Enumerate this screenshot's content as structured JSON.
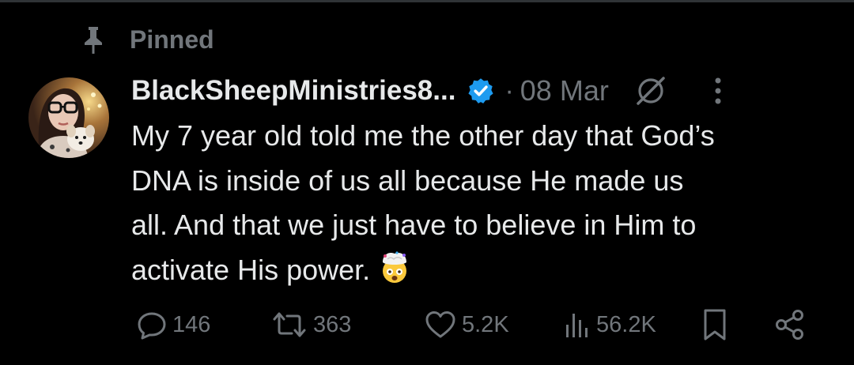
{
  "pinned": {
    "label": "Pinned",
    "icon": "pin-icon"
  },
  "post": {
    "author": {
      "display_name": "BlackSheepMinistries8...",
      "verified_icon": "verified-badge-icon",
      "avatar_icon": "profile-photo-avatar"
    },
    "separator": "·",
    "date": "08 Mar",
    "grok_icon": "grok-slash-circle-icon",
    "more_icon": "more-vertical-icon",
    "text": "My 7 year old told me the other day that God’s\nDNA is inside of us all because He made us\nall. And that we just have to believe in Him to\nactivate His power.",
    "emoji_icon": "exploding-head-emoji"
  },
  "actions": {
    "replies": {
      "count": "146",
      "icon": "reply-bubble-icon"
    },
    "reposts": {
      "count": "363",
      "icon": "repost-icon"
    },
    "likes": {
      "count": "5.2K",
      "icon": "heart-icon"
    },
    "views": {
      "count": "56.2K",
      "icon": "views-chart-icon"
    },
    "bookmark": {
      "icon": "bookmark-icon"
    },
    "share": {
      "icon": "share-icon"
    }
  },
  "colors": {
    "background": "#000000",
    "text_primary": "#e7e9ea",
    "text_secondary": "#71767b",
    "verified_blue": "#1d9bf0",
    "divider": "#2f3336"
  }
}
